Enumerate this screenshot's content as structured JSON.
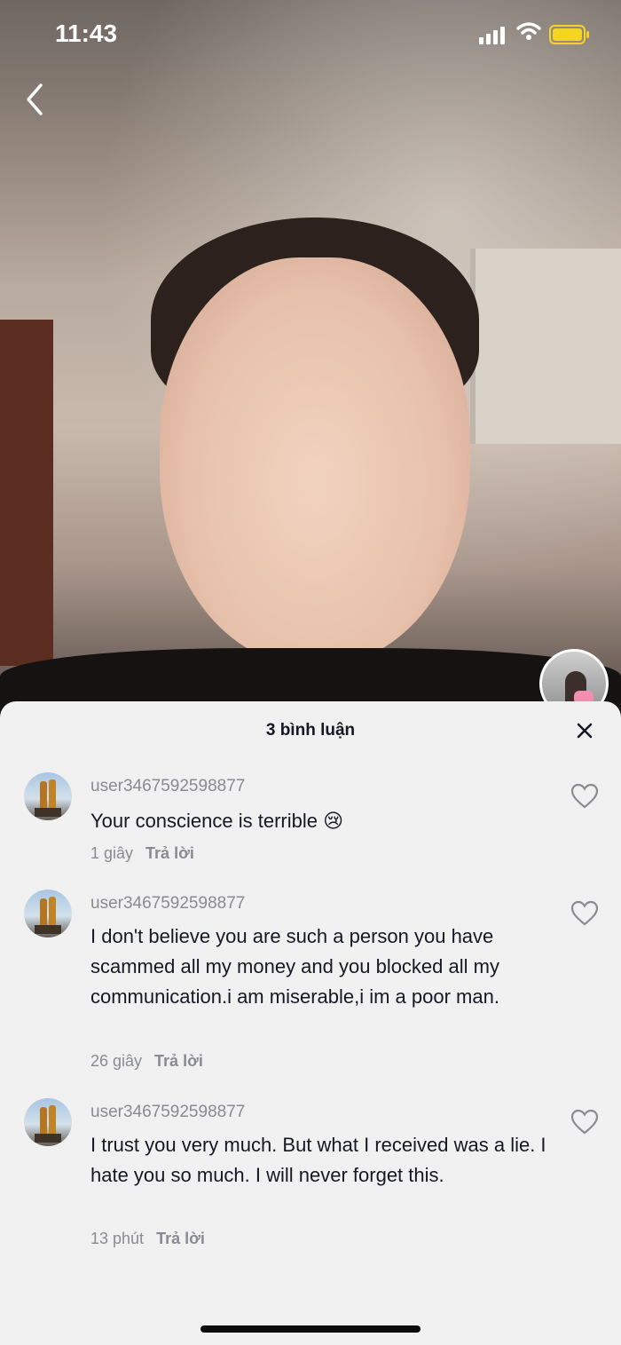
{
  "status_bar": {
    "time": "11:43"
  },
  "comments_panel": {
    "title": "3 bình luận",
    "reply_label": "Trả lời",
    "comments": [
      {
        "username": "user3467592598877",
        "text": "Your conscience is terrible 😢",
        "time": "1 giây"
      },
      {
        "username": "user3467592598877",
        "text": "I don't believe you are such a person you have scammed all my money and you blocked all my communication.i am miserable,i im a poor man.",
        "time": "26 giây"
      },
      {
        "username": "user3467592598877",
        "text": "I trust you very much. But what I received was a lie. I hate you so much. I will never forget this.",
        "time": "13 phút"
      }
    ]
  },
  "icons": [
    "back-chevron-icon",
    "signal-icon",
    "wifi-icon",
    "battery-icon",
    "close-icon",
    "heart-icon"
  ],
  "colors": {
    "sheet_bg": "#f1f1f1",
    "text": "#161823",
    "muted": "#8a8b91",
    "battery": "#f4d51f"
  }
}
